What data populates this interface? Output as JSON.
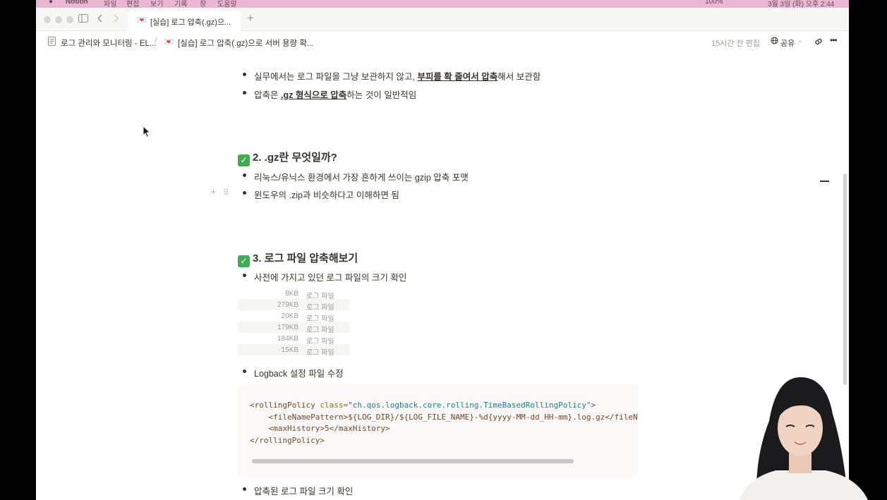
{
  "menubar": {
    "app": "Notion",
    "items": [
      "파일",
      "편집",
      "보기",
      "기록",
      "창",
      "도움말"
    ],
    "battery": "100%",
    "clock": "3월 3일 (화) 오후 2:44"
  },
  "tab": {
    "emoji": "💌",
    "title": "[실습] 로그 압축(.gz)으...",
    "new_tab": "+"
  },
  "breadcrumb": {
    "parent": "로그 관리와 모니터링 - EL...",
    "separator": "/",
    "current_emoji": "💌",
    "current": "[실습] 로그 압축(.gz)으로 서버 용량 확..."
  },
  "topbar": {
    "edited": "15시간 전 편집",
    "share": "공유",
    "more": "•••"
  },
  "section1": {
    "b1_pre": "실무에서는 로그 파일을 그냥 보관하지 않고, ",
    "b1_strong": "부피를 확 줄여서 압축",
    "b1_post": "해서 보관함",
    "b2_pre": "압축은 ",
    "b2_strong": ".gz 형식으로 압축",
    "b2_post": "하는 것이 일반적임"
  },
  "section2": {
    "check": "✓",
    "heading": "2. .gz란 무엇일까?",
    "b1": "리눅스/유닉스 환경에서 가장 흔하게 쓰이는 gzip 압축 포맷",
    "b2": "윈도우의 .zip과 비슷하다고 이해하면 됨"
  },
  "section3": {
    "check": "✓",
    "heading": "3. 로그 파일 압축해보기",
    "b1": "사전에 가지고 있던 로그 파일의 크기 확인",
    "files": [
      {
        "size": "8KB",
        "name": "로그 파일"
      },
      {
        "size": "279KB",
        "name": "로그 파일"
      },
      {
        "size": "20KB",
        "name": "로그 파일"
      },
      {
        "size": "179KB",
        "name": "로그 파일"
      },
      {
        "size": "184KB",
        "name": "로그 파일"
      },
      {
        "size": "15KB",
        "name": "로그 파일"
      }
    ],
    "b2": "Logback 설정 파일 수정",
    "code": {
      "l1_open": "<rollingPolicy ",
      "l1_attr": "class=",
      "l1_str": "\"ch.qos.logback.core.rolling.TimeBasedRollingPolicy\"",
      "l1_close": ">",
      "l2": "    <fileNamePattern>${LOG_DIR}/${LOG_FILE_NAME}-%d{yyyy-MM-dd_HH-mm}.log.gz</fileNamePattern>",
      "l3": "    <maxHistory>5</maxHistory>",
      "l4": "</rollingPolicy>"
    },
    "b3": "압축된 로그 파일 크기 확인"
  },
  "hover_handles": {
    "plus": "+",
    "drag": "⠿"
  }
}
